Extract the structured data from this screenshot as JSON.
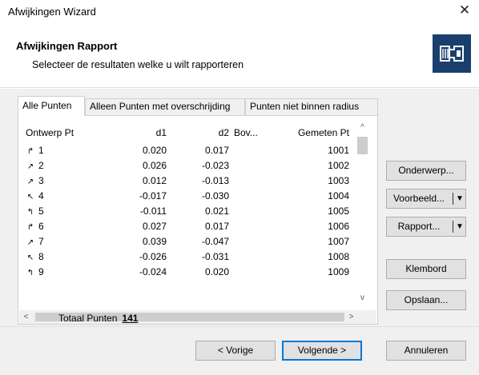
{
  "window": {
    "title": "Afwijkingen Wizard",
    "close_glyph": "✕"
  },
  "header": {
    "title": "Afwijkingen Rapport",
    "subtitle": "Selecteer de resultaten welke u wilt rapporteren",
    "logo_icon": "report-icon",
    "logo_color": "#1a3f6e"
  },
  "tabs": [
    {
      "label": "Alle Punten",
      "active": true
    },
    {
      "label": "Alleen Punten met overschrijding",
      "active": false
    },
    {
      "label": "Punten niet binnen radius",
      "active": false
    }
  ],
  "grid": {
    "columns": [
      "Ontwerp Pt",
      "d1",
      "d2",
      "Bov...",
      "Gemeten Pt"
    ],
    "rows": [
      {
        "icon": "↱",
        "pt": "1",
        "d1": "0.020",
        "d2": "0.017",
        "bov": "",
        "gem": "1001"
      },
      {
        "icon": "↗",
        "pt": "2",
        "d1": "0.026",
        "d2": "-0.023",
        "bov": "",
        "gem": "1002"
      },
      {
        "icon": "↗",
        "pt": "3",
        "d1": "0.012",
        "d2": "-0.013",
        "bov": "",
        "gem": "1003"
      },
      {
        "icon": "↖",
        "pt": "4",
        "d1": "-0.017",
        "d2": "-0.030",
        "bov": "",
        "gem": "1004"
      },
      {
        "icon": "↰",
        "pt": "5",
        "d1": "-0.011",
        "d2": "0.021",
        "bov": "",
        "gem": "1005"
      },
      {
        "icon": "↱",
        "pt": "6",
        "d1": "0.027",
        "d2": "0.017",
        "bov": "",
        "gem": "1006"
      },
      {
        "icon": "↗",
        "pt": "7",
        "d1": "0.039",
        "d2": "-0.047",
        "bov": "",
        "gem": "1007"
      },
      {
        "icon": "↖",
        "pt": "8",
        "d1": "-0.026",
        "d2": "-0.031",
        "bov": "",
        "gem": "1008"
      },
      {
        "icon": "↰",
        "pt": "9",
        "d1": "-0.024",
        "d2": "0.020",
        "bov": "",
        "gem": "1009"
      }
    ]
  },
  "scroll": {
    "up": "^",
    "down": "v",
    "left": "<",
    "right": ">"
  },
  "total": {
    "label": "Totaal Punten",
    "value": "141"
  },
  "side_buttons": {
    "onderwerp": "Onderwerp...",
    "voorbeeld": "Voorbeeld...",
    "rapport": "Rapport...",
    "klembord": "Klembord",
    "opslaan": "Opslaan...",
    "dropdown_arrow": "▼"
  },
  "nav_buttons": {
    "prev": "< Vorige",
    "next": "Volgende >",
    "cancel": "Annuleren"
  },
  "accent_color": "#0078d7"
}
